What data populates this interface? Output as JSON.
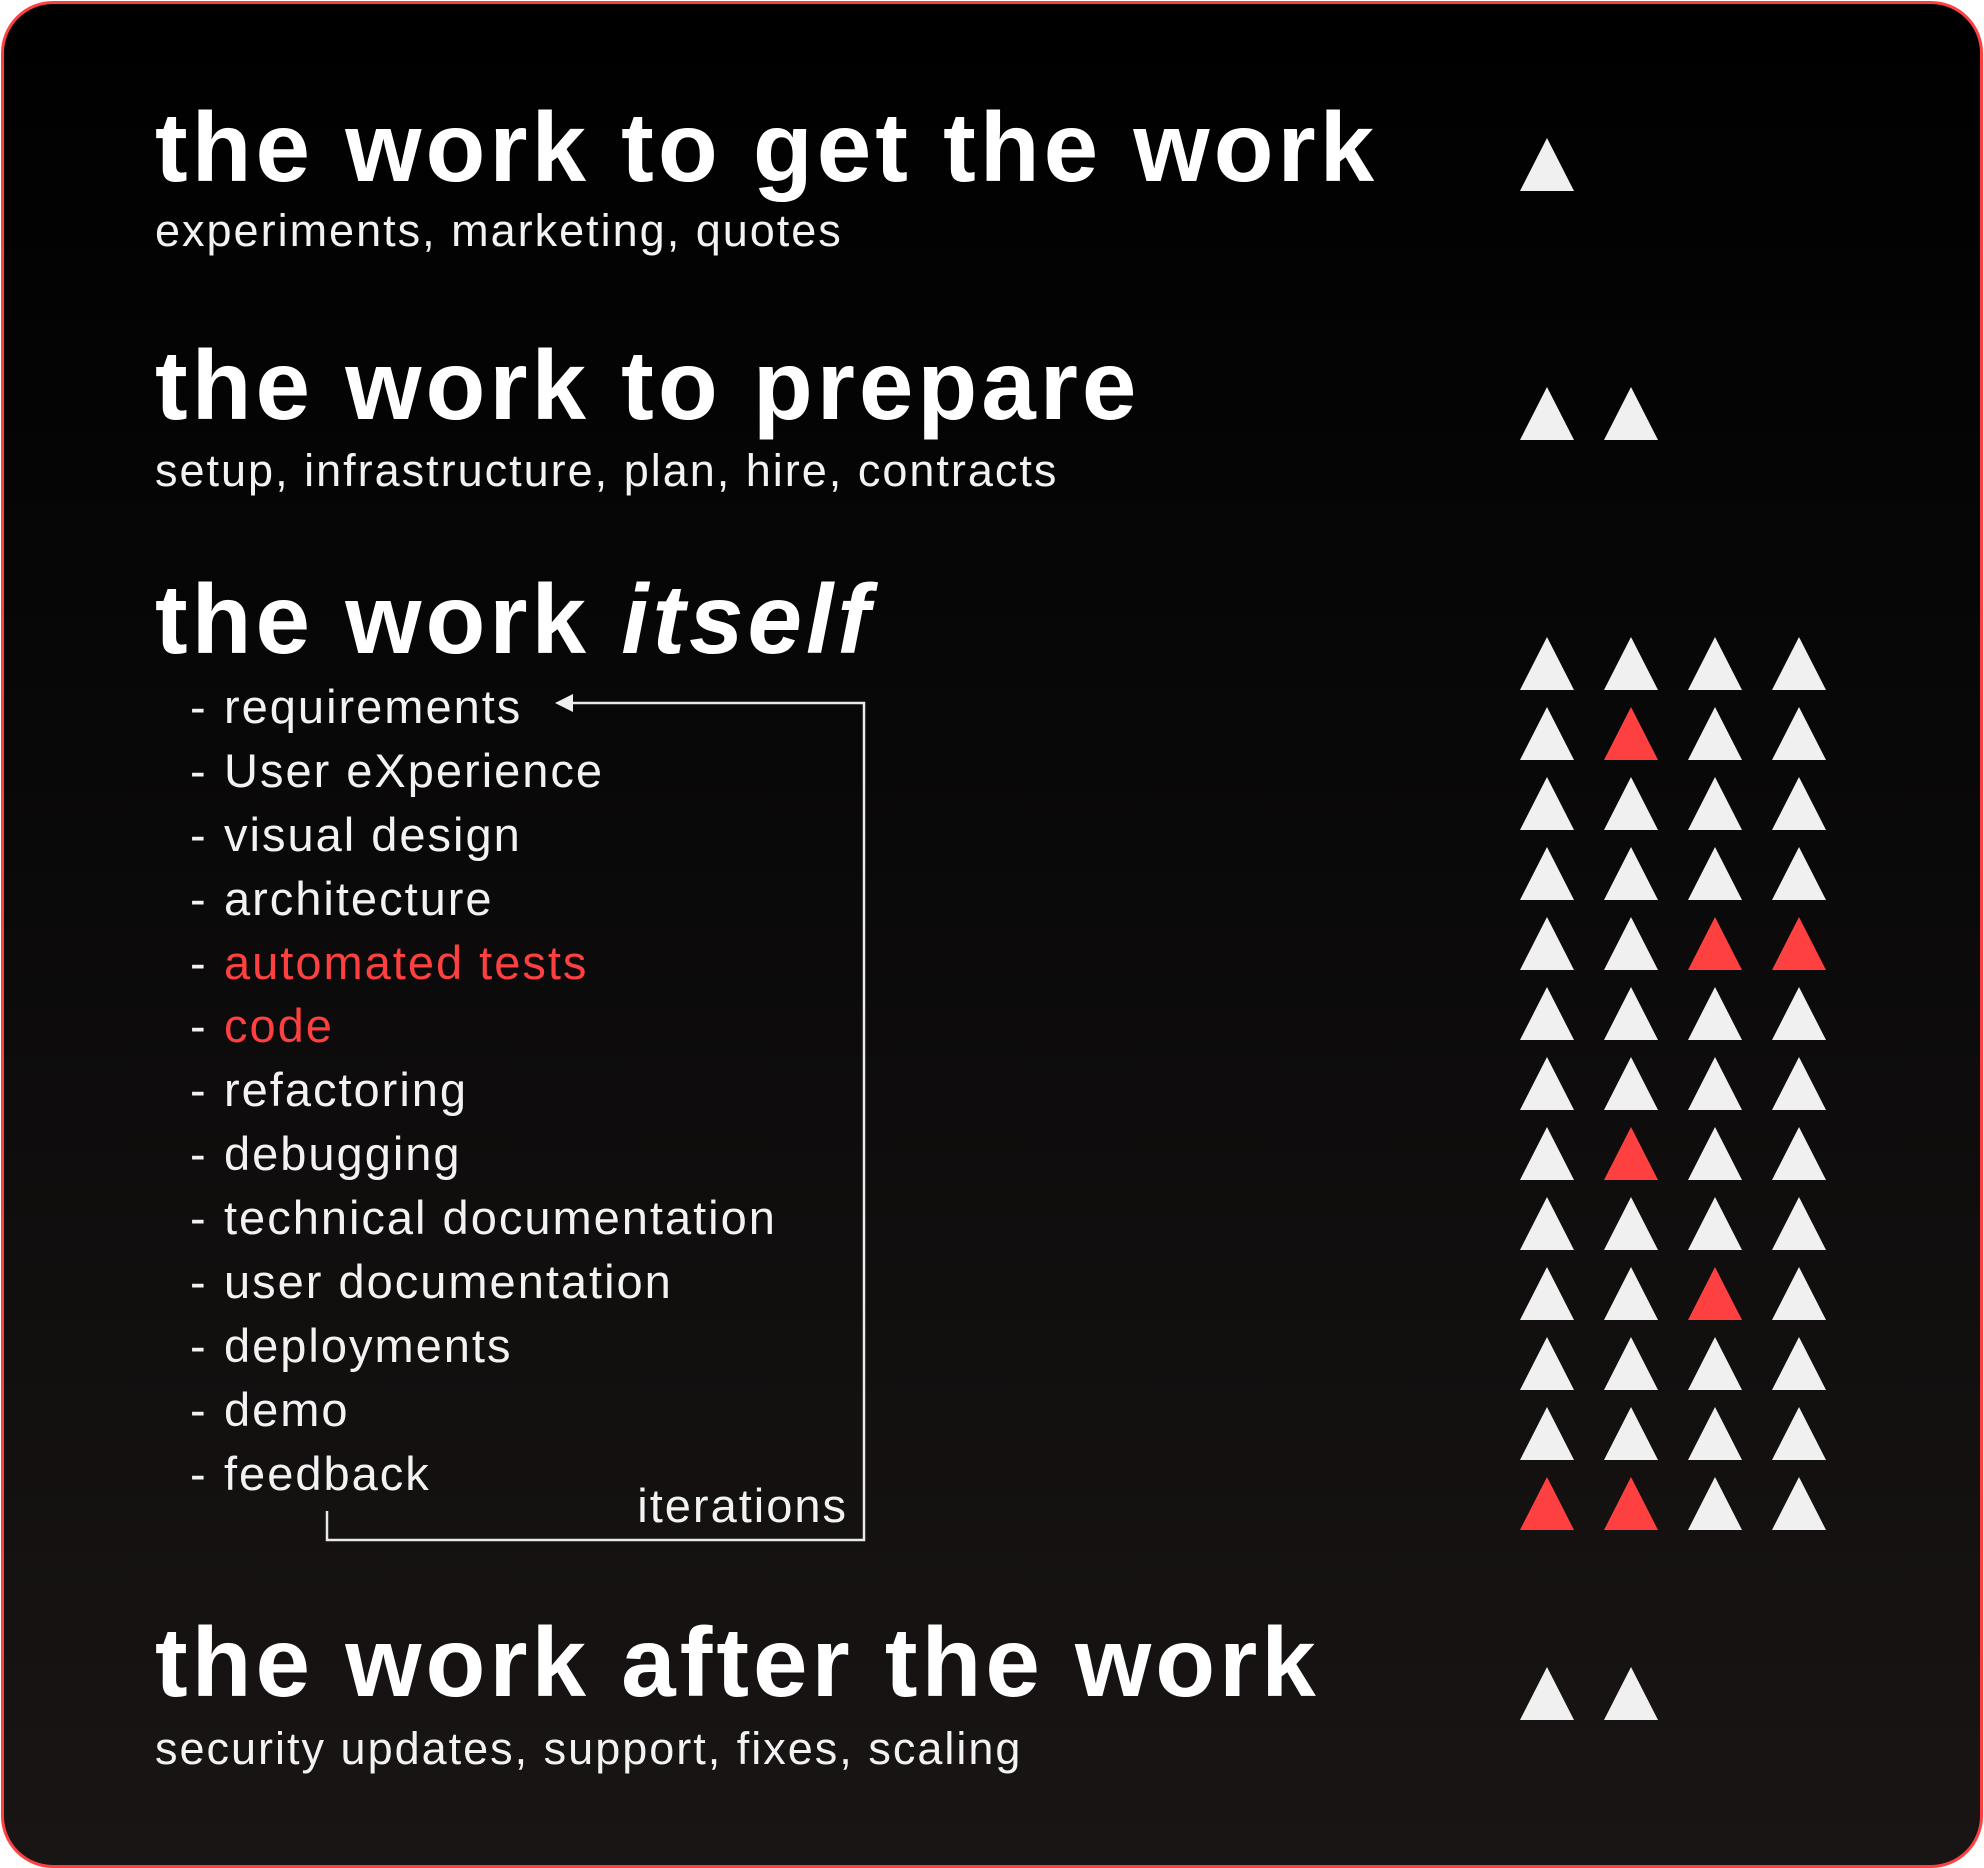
{
  "colors": {
    "accent": "#ff4040",
    "foreground": "#f0f0f0",
    "background": "#000000"
  },
  "sections": [
    {
      "title": "the work to get the work",
      "subtitle": "experiments, marketing, quotes",
      "effort_units": 1
    },
    {
      "title": "the work to prepare",
      "subtitle": "setup, infrastructure, plan, hire, contracts",
      "effort_units": 2
    },
    {
      "title_main": "the work ",
      "title_emphasis": "itself",
      "effort_units": 52
    },
    {
      "title": "the work after the work",
      "subtitle": "security updates, support, fixes, scaling",
      "effort_units": 2
    }
  ],
  "work_itself_items": [
    {
      "label": "requirements",
      "highlight": false
    },
    {
      "label": "User eXperience",
      "highlight": false
    },
    {
      "label": "visual design",
      "highlight": false
    },
    {
      "label": "architecture",
      "highlight": false
    },
    {
      "label": "automated tests",
      "highlight": true
    },
    {
      "label": "code",
      "highlight": true
    },
    {
      "label": "refactoring",
      "highlight": false
    },
    {
      "label": "debugging",
      "highlight": false
    },
    {
      "label": "technical documentation",
      "highlight": false
    },
    {
      "label": "user documentation",
      "highlight": false
    },
    {
      "label": "deployments",
      "highlight": false
    },
    {
      "label": "demo",
      "highlight": false
    },
    {
      "label": "feedback",
      "highlight": false
    }
  ],
  "list_dash": "-",
  "loop_label": "iterations",
  "triangle_grids": {
    "get_the_work": [
      [
        "w"
      ]
    ],
    "prepare": [
      [
        "w",
        "w"
      ]
    ],
    "itself": [
      [
        "w",
        "w",
        "w",
        "w"
      ],
      [
        "w",
        "r",
        "w",
        "w"
      ],
      [
        "w",
        "w",
        "w",
        "w"
      ],
      [
        "w",
        "w",
        "w",
        "w"
      ],
      [
        "w",
        "w",
        "r",
        "r"
      ],
      [
        "w",
        "w",
        "w",
        "w"
      ],
      [
        "w",
        "w",
        "w",
        "w"
      ],
      [
        "w",
        "r",
        "w",
        "w"
      ],
      [
        "w",
        "w",
        "w",
        "w"
      ],
      [
        "w",
        "w",
        "r",
        "w"
      ],
      [
        "w",
        "w",
        "w",
        "w"
      ],
      [
        "w",
        "w",
        "w",
        "w"
      ],
      [
        "r",
        "r",
        "w",
        "w"
      ]
    ],
    "after_the_work": [
      [
        "w",
        "w"
      ]
    ]
  }
}
